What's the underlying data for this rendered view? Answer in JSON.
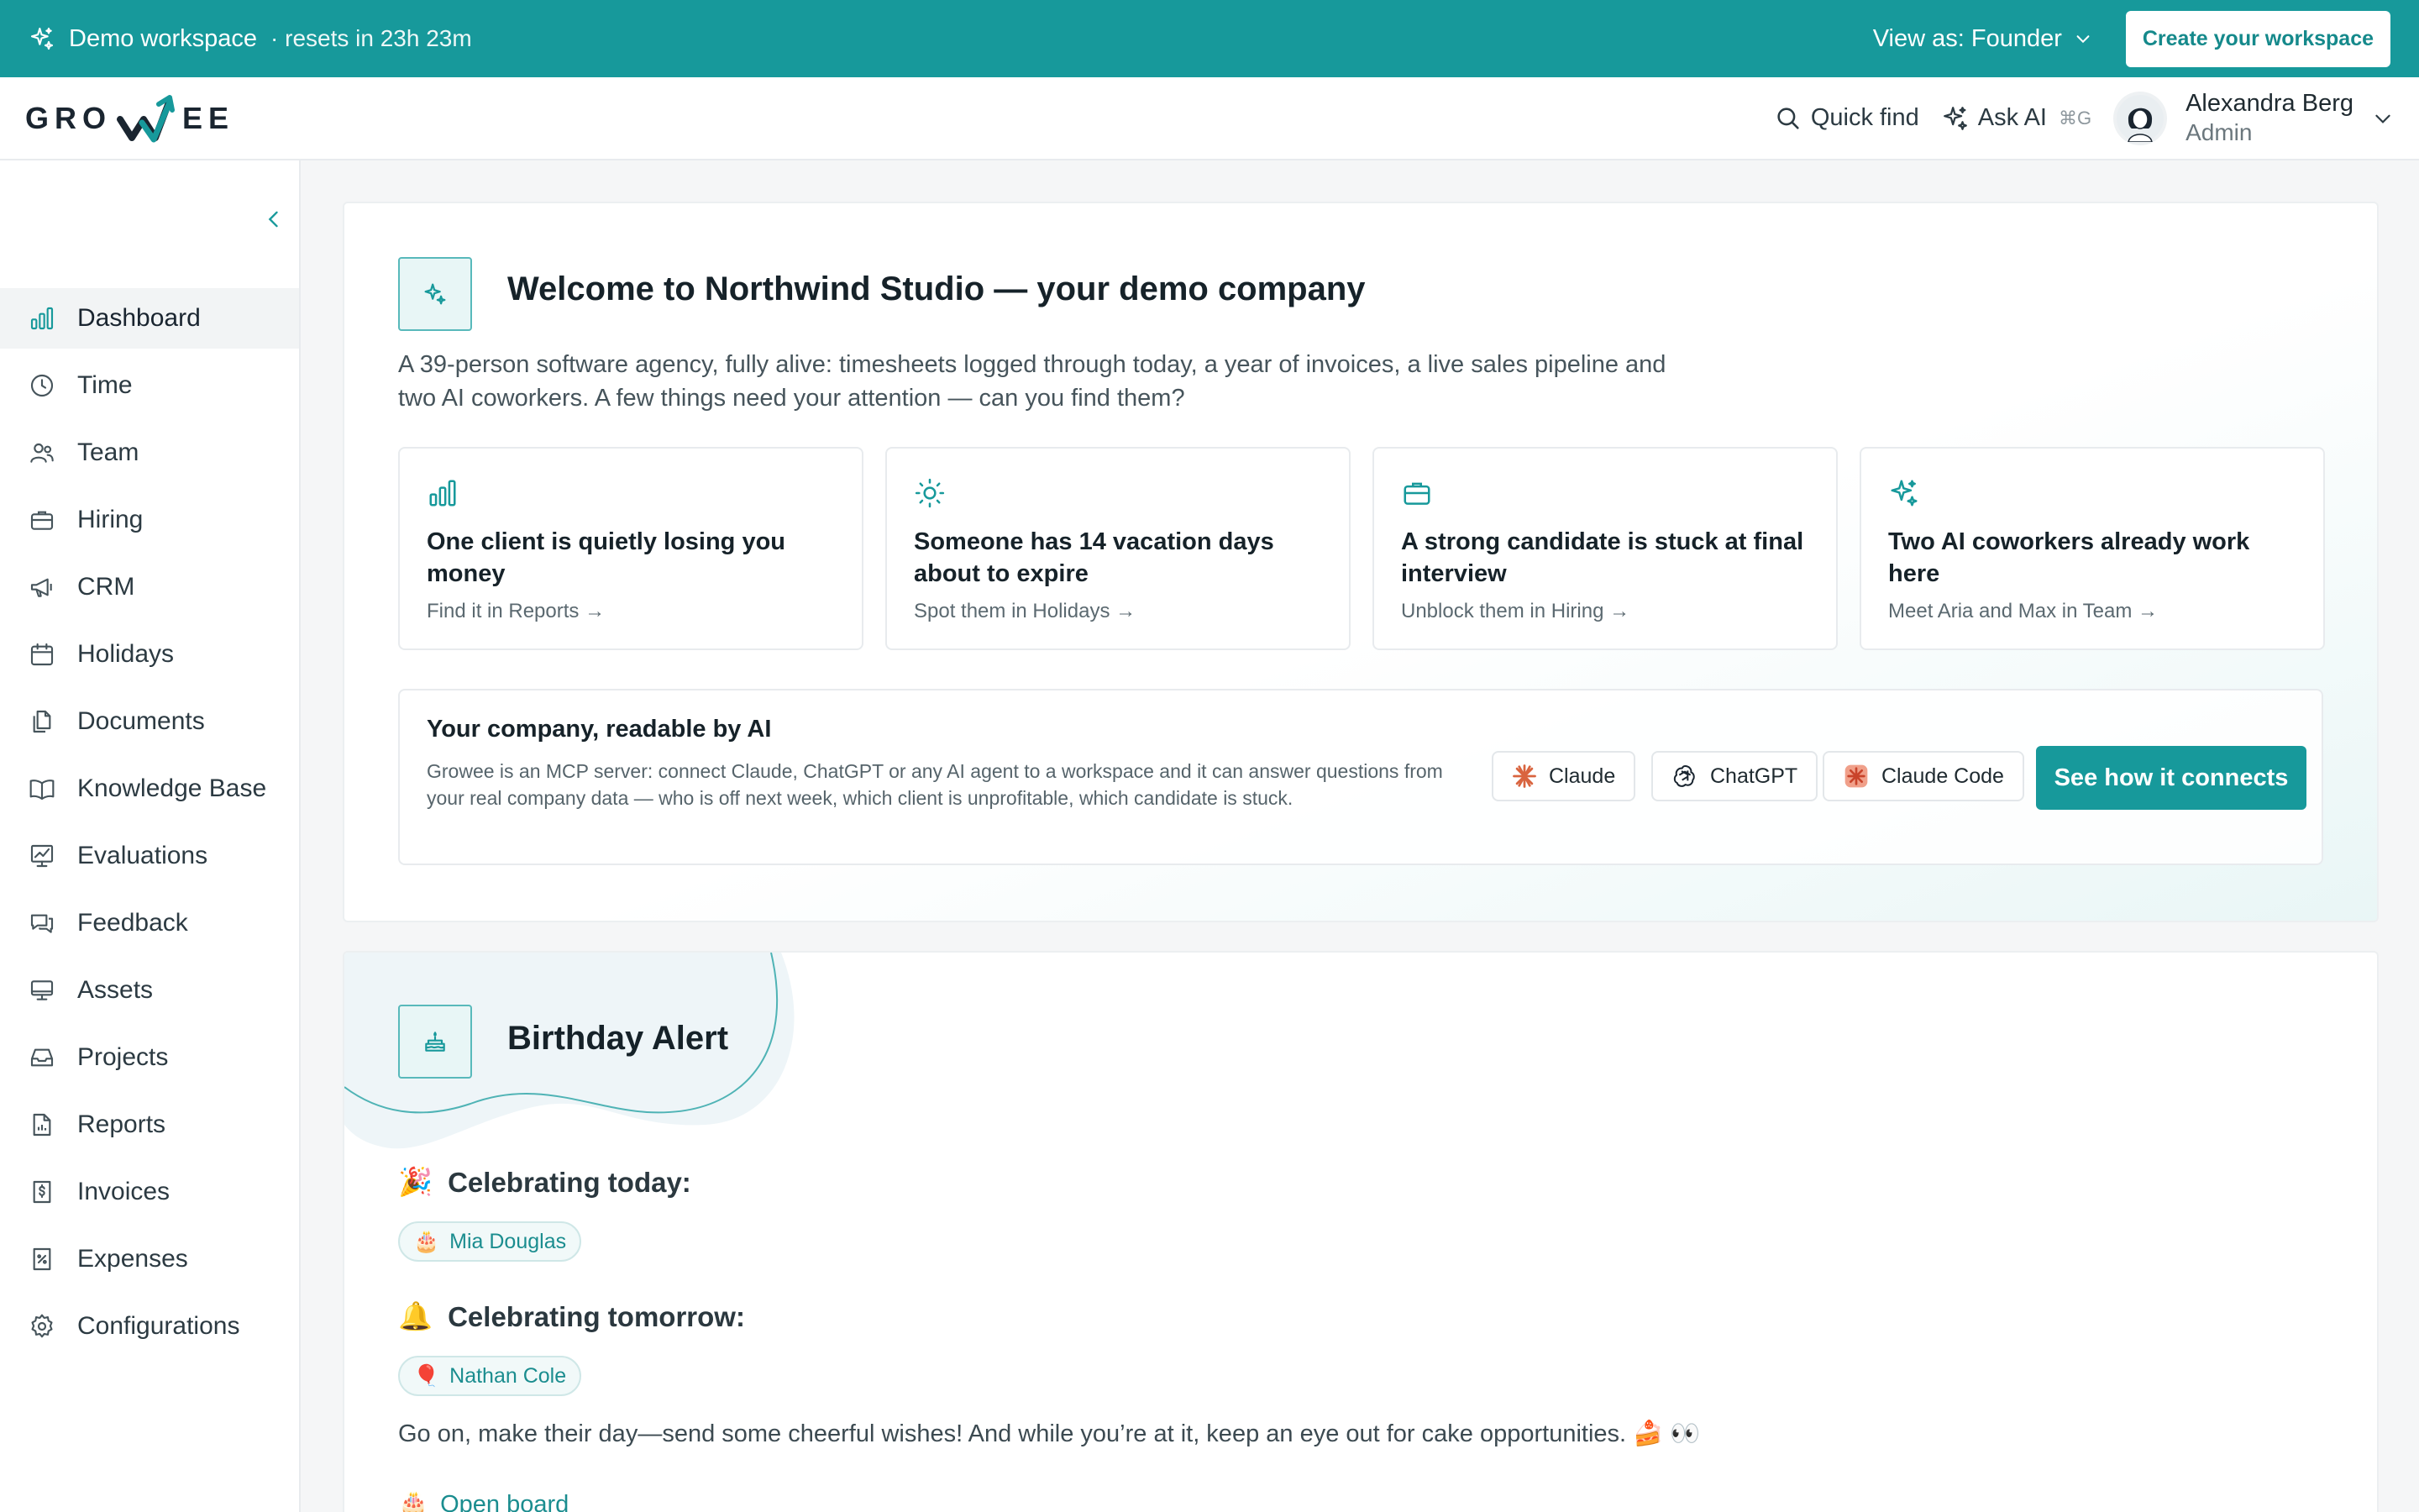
{
  "banner": {
    "workspace": "Demo workspace",
    "reset": "· resets in 23h 23m",
    "view_as": "View as: Founder",
    "create_button": "Create your workspace"
  },
  "header": {
    "logo_left": "GRO",
    "logo_right": "EE",
    "quick_find": "Quick find",
    "ask_ai": "Ask AI",
    "ask_ai_shortcut": "⌘G",
    "user_name": "Alexandra Berg",
    "user_role": "Admin"
  },
  "sidebar": {
    "active": "Dashboard",
    "items": [
      {
        "label": "Dashboard",
        "icon": "bar-chart-icon"
      },
      {
        "label": "Time",
        "icon": "clock-icon"
      },
      {
        "label": "Team",
        "icon": "users-icon"
      },
      {
        "label": "Hiring",
        "icon": "briefcase-icon"
      },
      {
        "label": "CRM",
        "icon": "megaphone-icon"
      },
      {
        "label": "Holidays",
        "icon": "calendar-icon"
      },
      {
        "label": "Documents",
        "icon": "documents-icon"
      },
      {
        "label": "Knowledge Base",
        "icon": "book-icon"
      },
      {
        "label": "Evaluations",
        "icon": "evaluation-icon"
      },
      {
        "label": "Feedback",
        "icon": "chat-icon"
      },
      {
        "label": "Assets",
        "icon": "monitor-icon"
      },
      {
        "label": "Projects",
        "icon": "inbox-icon"
      },
      {
        "label": "Reports",
        "icon": "report-icon"
      },
      {
        "label": "Invoices",
        "icon": "invoice-icon"
      },
      {
        "label": "Expenses",
        "icon": "expense-icon"
      },
      {
        "label": "Configurations",
        "icon": "gear-icon"
      }
    ]
  },
  "welcome": {
    "title": "Welcome to Northwind Studio — your demo company",
    "description": "A 39-person software agency, fully alive: timesheets logged through today, a year of invoices, a live sales pipeline and two AI coworkers. A few things need your attention — can you find them?",
    "tiles": [
      {
        "title": "One client is quietly losing you money",
        "link": "Find it in Reports →",
        "icon": "bar-chart-icon"
      },
      {
        "title": "Someone has 14 vacation days about to expire",
        "link": "Spot them in Holidays →",
        "icon": "sun-icon"
      },
      {
        "title": "A strong candidate is stuck at final interview",
        "link": "Unblock them in Hiring →",
        "icon": "briefcase-icon"
      },
      {
        "title": "Two AI coworkers already work here",
        "link": "Meet Aria and Max in Team →",
        "icon": "sparkles-icon"
      }
    ],
    "ai": {
      "title": "Your company, readable by AI",
      "description": "Growee is an MCP server: connect Claude, ChatGPT or any AI agent to a workspace and it can answer questions from your real company data — who is off next week, which client is unprofitable, which candidate is stuck.",
      "chips": [
        "Claude",
        "ChatGPT",
        "Claude Code"
      ],
      "cta": "See how it connects"
    }
  },
  "birthday": {
    "title": "Birthday Alert",
    "today_label": "Celebrating today:",
    "today_emoji": "🎉",
    "today_person": "Mia Douglas",
    "today_person_emoji": "🎂",
    "tomorrow_label": "Celebrating tomorrow:",
    "tomorrow_emoji": "🔔",
    "tomorrow_person": "Nathan Cole",
    "tomorrow_person_emoji": "🎈",
    "message": "Go on, make their day—send some cheerful wishes! And while you’re at it, keep an eye out for cake opportunities. 🍰 👀",
    "open_board": "Open board",
    "open_board_emoji": "🎂"
  },
  "colors": {
    "brand": "#17999b",
    "brand_dark": "#15898b",
    "text": "#1f2a30"
  }
}
